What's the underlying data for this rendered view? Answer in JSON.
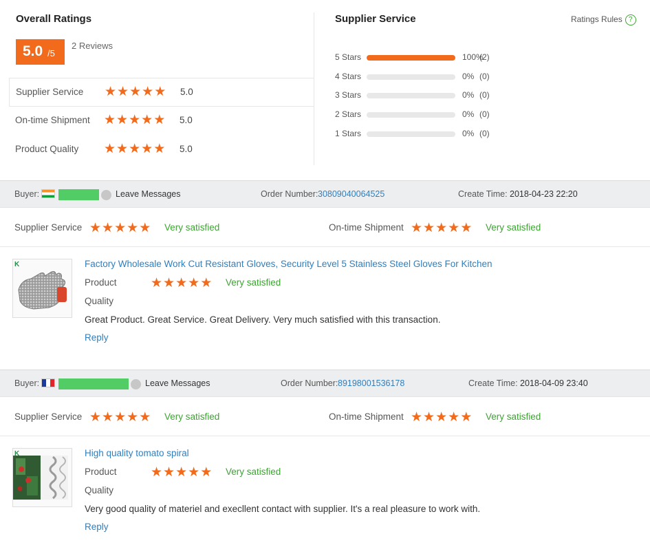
{
  "overall": {
    "title": "Overall Ratings",
    "score": "5.0",
    "score_max": "/5",
    "reviews": "2 Reviews",
    "rows": [
      {
        "label": "Supplier Service",
        "stars": 5,
        "value": "5.0"
      },
      {
        "label": "On-time Shipment",
        "stars": 5,
        "value": "5.0"
      },
      {
        "label": "Product Quality",
        "stars": 5,
        "value": "5.0"
      }
    ]
  },
  "supplier_service": {
    "title": "Supplier Service",
    "rules_label": "Ratings Rules",
    "rules_icon": "question-circle-icon",
    "distribution": [
      {
        "label": "5 Stars",
        "fraction": 1.0,
        "percent": "100%",
        "count": "(2)"
      },
      {
        "label": "4 Stars",
        "fraction": 0,
        "percent": "0%",
        "count": "(0)"
      },
      {
        "label": "3 Stars",
        "fraction": 0,
        "percent": "0%",
        "count": "(0)"
      },
      {
        "label": "2 Stars",
        "fraction": 0,
        "percent": "0%",
        "count": "(0)"
      },
      {
        "label": "1 Stars",
        "fraction": 0,
        "percent": "0%",
        "count": "(0)"
      }
    ]
  },
  "colors": {
    "accent": "#f26a1b",
    "link": "#2f7fbf",
    "satisfied": "#3aa52f"
  },
  "reviews": [
    {
      "buyer_label": "Buyer:",
      "flag": "india-flag-icon",
      "leave_messages": "Leave Messages",
      "order_label": "Order Number:",
      "order_number": "30809040064525",
      "create_label": "Create Time:",
      "create_time": "2018-04-23 22:20",
      "supplier_service_label": "Supplier Service",
      "supplier_service_stars": 5,
      "supplier_service_text": "Very satisfied",
      "shipment_label": "On-time Shipment",
      "shipment_stars": 5,
      "shipment_text": "Very satisfied",
      "product_title": "Factory Wholesale Work Cut Resistant Gloves, Security Level 5 Stainless Steel Gloves For Kitchen",
      "product_icon": "steel-glove-thumbnail",
      "product_label": "Product",
      "quality_label": "Quality",
      "product_stars": 5,
      "product_text": "Very satisfied",
      "comment": "Great Product. Great Service. Great Delivery. Very much satisfied with this transaction.",
      "reply": "Reply"
    },
    {
      "buyer_label": "Buyer:",
      "flag": "france-flag-icon",
      "leave_messages": "Leave Messages",
      "order_label": "Order Number:",
      "order_number": "89198001536178",
      "create_label": "Create Time:",
      "create_time": "2018-04-09 23:40",
      "supplier_service_label": "Supplier Service",
      "supplier_service_stars": 5,
      "supplier_service_text": "Very satisfied",
      "shipment_label": "On-time Shipment",
      "shipment_stars": 5,
      "shipment_text": "Very satisfied",
      "product_title": "High quality tomato spiral",
      "product_icon": "tomato-spiral-thumbnail",
      "product_label": "Product",
      "quality_label": "Quality",
      "product_stars": 5,
      "product_text": "Very satisfied",
      "comment": "Very good quality of materiel and execllent contact with supplier. It's a real pleasure to work with.",
      "reply": "Reply"
    }
  ]
}
